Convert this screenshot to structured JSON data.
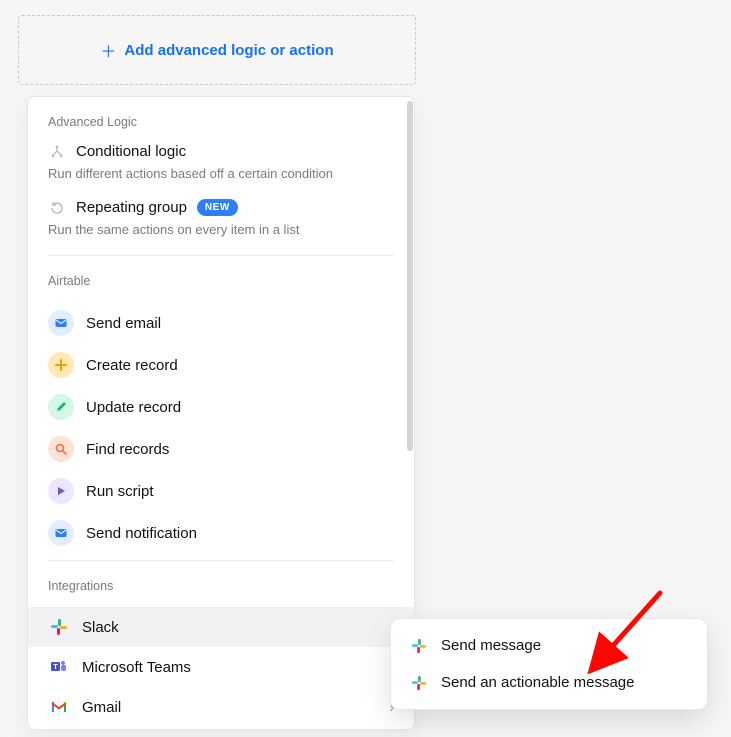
{
  "add_button_label": "Add advanced logic or action",
  "sections": {
    "advanced_logic": {
      "title": "Advanced Logic",
      "items": [
        {
          "title": "Conditional logic",
          "desc": "Run different actions based off a certain condition",
          "badge": null
        },
        {
          "title": "Repeating group",
          "desc": "Run the same actions on every item in a list",
          "badge": "NEW"
        }
      ]
    },
    "airtable": {
      "title": "Airtable",
      "items": [
        {
          "label": "Send email"
        },
        {
          "label": "Create record"
        },
        {
          "label": "Update record"
        },
        {
          "label": "Find records"
        },
        {
          "label": "Run script"
        },
        {
          "label": "Send notification"
        }
      ]
    },
    "integrations": {
      "title": "Integrations",
      "items": [
        {
          "label": "Slack"
        },
        {
          "label": "Microsoft Teams"
        },
        {
          "label": "Gmail"
        }
      ]
    }
  },
  "submenu": {
    "items": [
      {
        "label": "Send message"
      },
      {
        "label": "Send an actionable message"
      }
    ]
  },
  "colors": {
    "accent": "#1672f2",
    "badge": "#2d7ff9"
  }
}
